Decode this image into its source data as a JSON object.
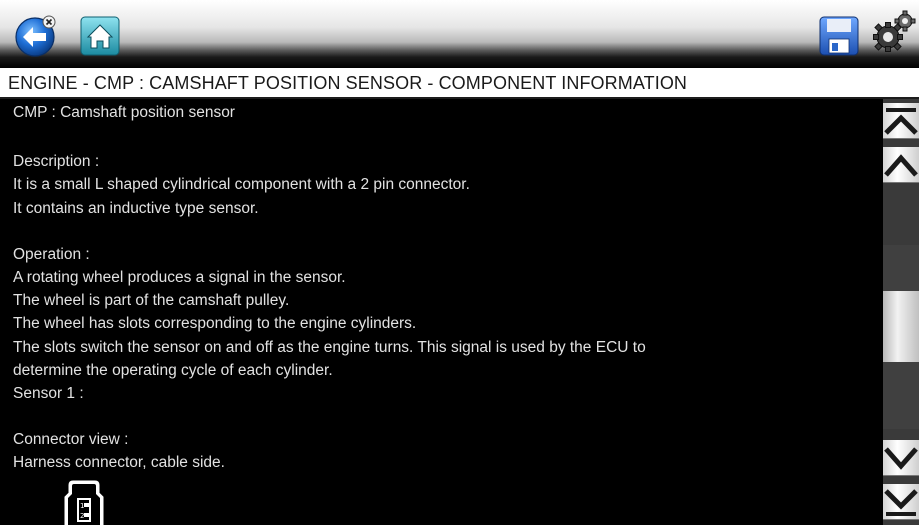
{
  "toolbar": {
    "back_icon": "back-arrow-icon",
    "home_icon": "home-icon",
    "save_icon": "save-disk-icon",
    "tools_icon": "gears-icon",
    "colors": {
      "back_blue": "#1f6fd6",
      "home_teal": "#2a9bb0",
      "save_blue": "#2b67c9"
    }
  },
  "title": "ENGINE - CMP : CAMSHAFT POSITION SENSOR - COMPONENT INFORMATION",
  "content": {
    "lines": [
      "CMP : Camshaft position sensor",
      "",
      "Description :",
      "It is a small L shaped cylindrical component with a 2 pin connector.",
      "It contains an inductive type sensor.",
      "",
      "Operation :",
      "A rotating wheel produces a signal in the sensor.",
      "The wheel is part of the camshaft pulley.",
      "The wheel has slots corresponding to the engine cylinders.",
      "The slots switch the sensor on and off as the engine turns. This signal is used by the ECU to",
      "determine the operating cycle of each cylinder.",
      "Sensor 1 :",
      "",
      "Connector view :",
      "Harness connector, cable side."
    ],
    "connector_icon": "connector-diagram-icon"
  },
  "scrollbar": {
    "top_icon": "scroll-to-top-icon",
    "up_icon": "scroll-up-icon",
    "down_icon": "scroll-down-icon",
    "bottom_icon": "scroll-to-bottom-icon",
    "position": 0.41
  }
}
